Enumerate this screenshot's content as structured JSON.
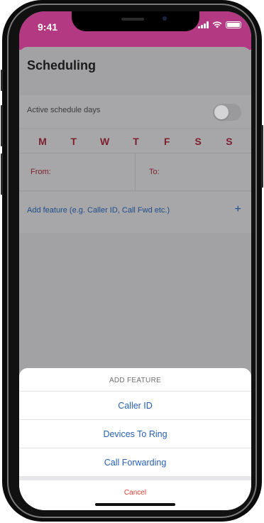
{
  "status_bar": {
    "time": "9:41"
  },
  "page": {
    "title": "Scheduling",
    "active_schedule_label": "Active schedule days",
    "days": [
      "M",
      "T",
      "W",
      "T",
      "F",
      "S",
      "S"
    ],
    "from_label": "From:",
    "to_label": "To:",
    "add_feature_label": "Add feature (e.g. Caller ID, Call Fwd etc.)",
    "add_feature_plus": "+"
  },
  "action_sheet": {
    "title": "ADD FEATURE",
    "options": [
      "Caller ID",
      "Devices To Ring",
      "Call Forwarding"
    ],
    "cancel": "Cancel"
  },
  "colors": {
    "status_bar_bg": "#b33a82",
    "accent_blue": "#2660b4",
    "day_red": "#7d1f2e",
    "cancel_red": "#e23a2f"
  }
}
